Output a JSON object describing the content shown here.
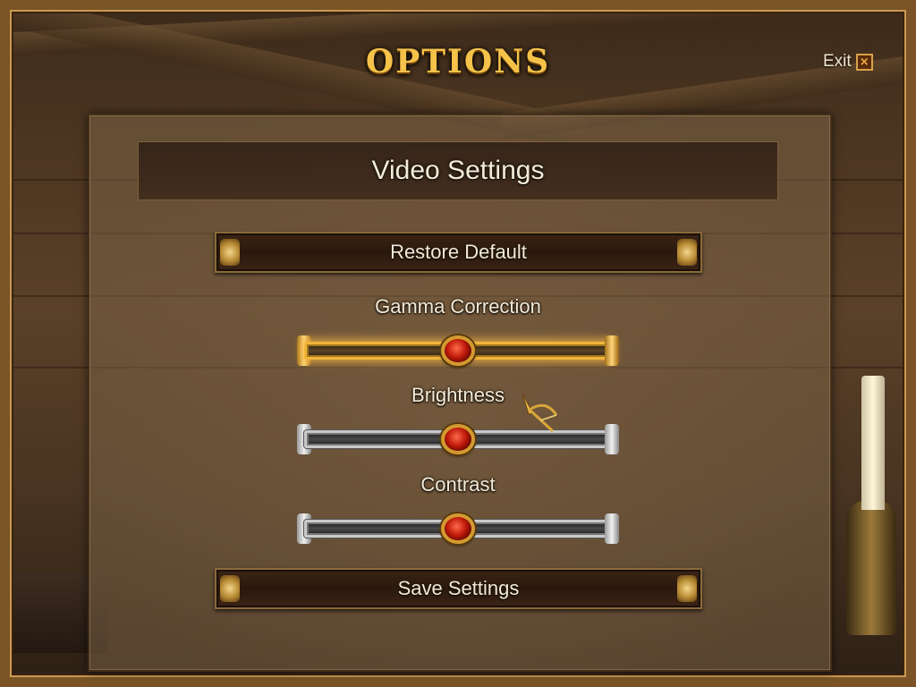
{
  "screen": {
    "title": "OPTIONS",
    "exit_label": "Exit",
    "exit_icon": "×"
  },
  "panel": {
    "header": "Video Settings",
    "restore_label": "Restore Default",
    "save_label": "Save Settings"
  },
  "sliders": [
    {
      "label": "Gamma Correction",
      "value": 0.5,
      "active": true
    },
    {
      "label": "Brightness",
      "value": 0.5,
      "active": false
    },
    {
      "label": "Contrast",
      "value": 0.5,
      "active": false
    }
  ],
  "colors": {
    "title_gold": "#f5c24a",
    "knob_red": "#c01a0a",
    "active_glow": "#f0b43a"
  },
  "icons": [
    "close-icon",
    "ornament-icon",
    "crossbow-cursor-icon"
  ]
}
